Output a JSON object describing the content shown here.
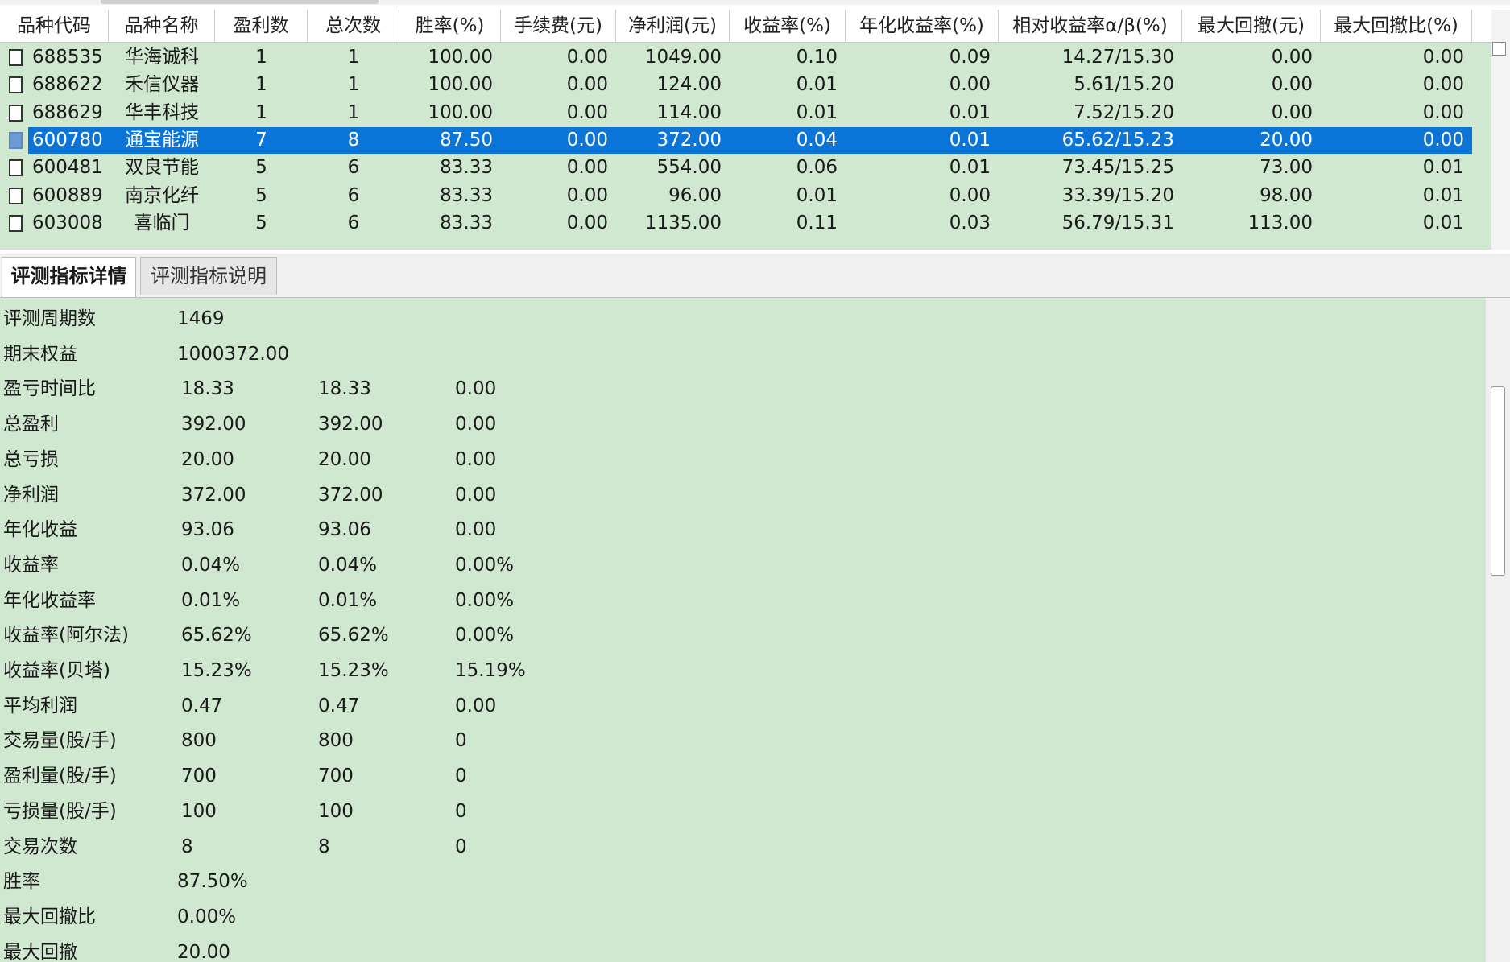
{
  "grid": {
    "columns": [
      "品种代码",
      "品种名称",
      "盈利数",
      "总次数",
      "胜率(%)",
      "手续费(元)",
      "净利润(元)",
      "收益率(%)",
      "年化收益率(%)",
      "相对收益率α/β(%)",
      "最大回撤(元)",
      "最大回撤比(%)"
    ],
    "rows": [
      {
        "code": "688535",
        "name": "华海诚科",
        "wins": "1",
        "total": "1",
        "winrate": "100.00",
        "fee": "0.00",
        "net": "1049.00",
        "ret": "0.10",
        "annual": "0.09",
        "rel": "14.27/15.30",
        "dd": "0.00",
        "ddr": "0.00",
        "selected": false
      },
      {
        "code": "688622",
        "name": "禾信仪器",
        "wins": "1",
        "total": "1",
        "winrate": "100.00",
        "fee": "0.00",
        "net": "124.00",
        "ret": "0.01",
        "annual": "0.00",
        "rel": "5.61/15.20",
        "dd": "0.00",
        "ddr": "0.00",
        "selected": false
      },
      {
        "code": "688629",
        "name": "华丰科技",
        "wins": "1",
        "total": "1",
        "winrate": "100.00",
        "fee": "0.00",
        "net": "114.00",
        "ret": "0.01",
        "annual": "0.01",
        "rel": "7.52/15.20",
        "dd": "0.00",
        "ddr": "0.00",
        "selected": false
      },
      {
        "code": "600780",
        "name": "通宝能源",
        "wins": "7",
        "total": "8",
        "winrate": "87.50",
        "fee": "0.00",
        "net": "372.00",
        "ret": "0.04",
        "annual": "0.01",
        "rel": "65.62/15.23",
        "dd": "20.00",
        "ddr": "0.00",
        "selected": true
      },
      {
        "code": "600481",
        "name": "双良节能",
        "wins": "5",
        "total": "6",
        "winrate": "83.33",
        "fee": "0.00",
        "net": "554.00",
        "ret": "0.06",
        "annual": "0.01",
        "rel": "73.45/15.25",
        "dd": "73.00",
        "ddr": "0.01",
        "selected": false
      },
      {
        "code": "600889",
        "name": "南京化纤",
        "wins": "5",
        "total": "6",
        "winrate": "83.33",
        "fee": "0.00",
        "net": "96.00",
        "ret": "0.01",
        "annual": "0.00",
        "rel": "33.39/15.20",
        "dd": "98.00",
        "ddr": "0.01",
        "selected": false
      },
      {
        "code": "603008",
        "name": "喜临门",
        "wins": "5",
        "total": "6",
        "winrate": "83.33",
        "fee": "0.00",
        "net": "1135.00",
        "ret": "0.11",
        "annual": "0.03",
        "rel": "56.79/15.31",
        "dd": "113.00",
        "ddr": "0.01",
        "selected": false
      }
    ]
  },
  "tabs": [
    {
      "label": "评测指标详情",
      "active": true
    },
    {
      "label": "评测指标说明",
      "active": false
    }
  ],
  "details": [
    {
      "label": "评测周期数",
      "values": [
        "1469"
      ]
    },
    {
      "label": "期末权益",
      "values": [
        "1000372.00"
      ]
    },
    {
      "label": "盈亏时间比",
      "values": [
        "18.33",
        "18.33",
        "0.00"
      ]
    },
    {
      "label": "总盈利",
      "values": [
        "392.00",
        "392.00",
        "0.00"
      ]
    },
    {
      "label": "总亏损",
      "values": [
        "20.00",
        "20.00",
        "0.00"
      ]
    },
    {
      "label": "净利润",
      "values": [
        "372.00",
        "372.00",
        "0.00"
      ]
    },
    {
      "label": "年化收益",
      "values": [
        "93.06",
        "93.06",
        "0.00"
      ]
    },
    {
      "label": "收益率",
      "values": [
        "0.04%",
        "0.04%",
        "0.00%"
      ]
    },
    {
      "label": "年化收益率",
      "values": [
        "0.01%",
        "0.01%",
        "0.00%"
      ]
    },
    {
      "label": "收益率(阿尔法)",
      "values": [
        "65.62%",
        "65.62%",
        "0.00%"
      ]
    },
    {
      "label": "收益率(贝塔)",
      "values": [
        "15.23%",
        "15.23%",
        "15.19%"
      ]
    },
    {
      "label": "平均利润",
      "values": [
        "0.47",
        "0.47",
        "0.00"
      ]
    },
    {
      "label": "交易量(股/手)",
      "values": [
        "800",
        "800",
        "0"
      ]
    },
    {
      "label": "盈利量(股/手)",
      "values": [
        "700",
        "700",
        "0"
      ]
    },
    {
      "label": "亏损量(股/手)",
      "values": [
        "100",
        "100",
        "0"
      ]
    },
    {
      "label": "交易次数",
      "values": [
        "8",
        "8",
        "0"
      ]
    },
    {
      "label": "胜率",
      "values": [
        "87.50%"
      ]
    },
    {
      "label": "最大回撤比",
      "values": [
        "0.00%"
      ]
    },
    {
      "label": "最大回撤",
      "values": [
        "20.00"
      ]
    }
  ],
  "colors": {
    "panel_bg": "#cfe8cf",
    "selection": "#0a74d8"
  },
  "icons": {
    "row_checkbox": "checkbox-icon",
    "scroll_box": "scroll-box-icon"
  }
}
